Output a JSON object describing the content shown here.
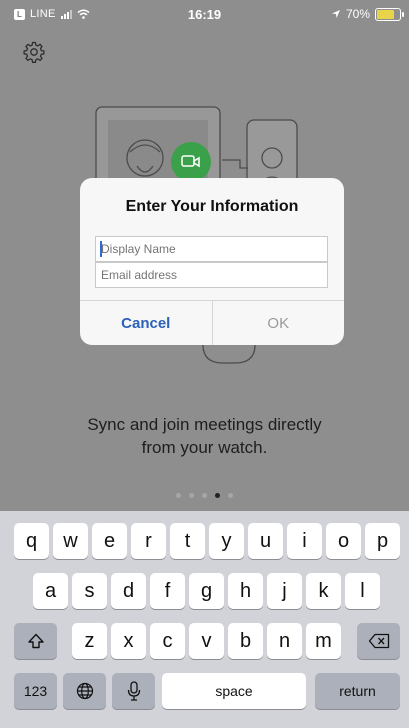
{
  "status_bar": {
    "carrier": "LINE",
    "time": "16:19",
    "battery": "70%"
  },
  "settings_icon": "gear-icon",
  "promo": {
    "line1": "Sync and join meetings directly",
    "line2": "from your watch."
  },
  "pager": {
    "count": 5,
    "active_index": 3
  },
  "dialog": {
    "title": "Enter Your Information",
    "display_name_placeholder": "Display Name",
    "email_placeholder": "Email address",
    "cancel_label": "Cancel",
    "ok_label": "OK"
  },
  "keyboard": {
    "row1": [
      "q",
      "w",
      "e",
      "r",
      "t",
      "y",
      "u",
      "i",
      "o",
      "p"
    ],
    "row2": [
      "a",
      "s",
      "d",
      "f",
      "g",
      "h",
      "j",
      "k",
      "l"
    ],
    "row3": [
      "z",
      "x",
      "c",
      "v",
      "b",
      "n",
      "m"
    ],
    "numbers_label": "123",
    "space_label": "space",
    "return_label": "return"
  },
  "colors": {
    "accent": "#2b62ba",
    "video_button": "#3aa14a",
    "battery": "#e8d34a"
  }
}
